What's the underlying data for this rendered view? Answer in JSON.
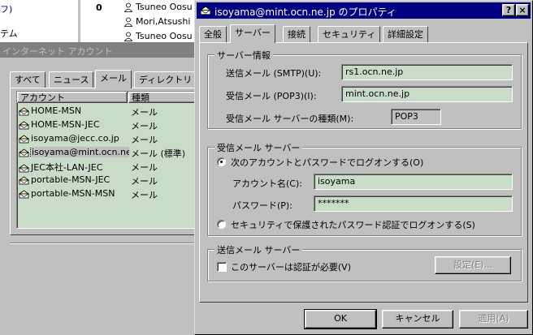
{
  "bg_left": {
    "partial_text_1": "フ)",
    "partial_text_2": "テム",
    "number": "0",
    "contacts": [
      "Tsuneo Oosu",
      "Mori,Atsushi",
      "Tsuneo Oosu"
    ]
  },
  "accounts_window": {
    "title": "インターネット アカウント",
    "tabs": [
      "すべて",
      "ニュース",
      "メール",
      "ディレクトリ サ"
    ],
    "active_tab": 2,
    "columns": [
      "アカウント",
      "種類"
    ],
    "rows": [
      {
        "name": "HOME-MSN",
        "type": "メール"
      },
      {
        "name": "HOME-MSN-JEC",
        "type": "メール"
      },
      {
        "name": "isoyama@jecc.co.jp",
        "type": "メール"
      },
      {
        "name": "isoyama@mint.ocn.ne.jp",
        "type": "メール (標準)"
      },
      {
        "name": "JEC本社-LAN-JEC",
        "type": "メール"
      },
      {
        "name": "portable-MSN-JEC",
        "type": "メール"
      },
      {
        "name": "portable-MSN-MSN",
        "type": "メール"
      }
    ],
    "selected_row": 3
  },
  "props_dialog": {
    "title": "isoyama@mint.ocn.ne.jp のプロパティ",
    "help_btn": "?",
    "close_btn": "×",
    "tabs": [
      "全般",
      "サーバー",
      "接続",
      "セキュリティ",
      "詳細設定"
    ],
    "active_tab": 1,
    "server_info": {
      "title": "サーバー情報",
      "smtp_label": "送信メール (SMTP)(U):",
      "smtp_value": "rs1.ocn.ne.jp",
      "pop3_label": "受信メール (POP3)(I):",
      "pop3_value": "mint.ocn.ne.jp",
      "type_label": "受信メール サーバーの種類(M):",
      "type_value": "POP3"
    },
    "incoming": {
      "title": "受信メール サーバー",
      "radio1_label": "次のアカウントとパスワードでログオンする(O)",
      "account_label": "アカウント名(C):",
      "account_value": "isoyama",
      "password_label": "パスワード(P):",
      "password_value": "*******",
      "radio2_label": "セキュリティで保護されたパスワード認証でログオンする(S)"
    },
    "outgoing": {
      "title": "送信メール サーバー",
      "check_label": "このサーバーは認証が必要(V)",
      "settings_btn": "設定(E)..."
    },
    "buttons": {
      "ok": "OK",
      "cancel": "キャンセル",
      "apply": "適用(A)"
    }
  }
}
